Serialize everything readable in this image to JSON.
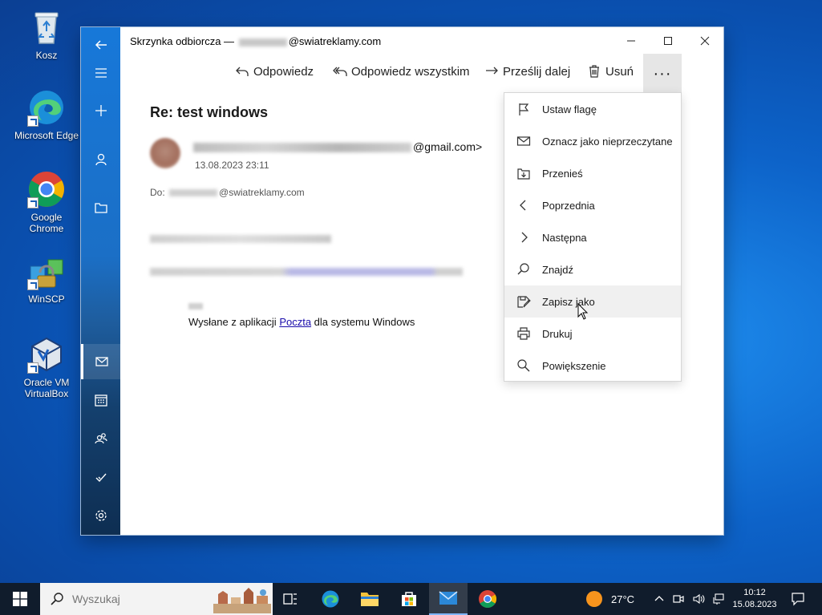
{
  "desktop": {
    "icons": [
      {
        "label": "Kosz"
      },
      {
        "label": "Microsoft Edge"
      },
      {
        "label": "Google Chrome"
      },
      {
        "label": "WinSCP"
      },
      {
        "label": "Oracle VM VirtualBox"
      }
    ]
  },
  "window": {
    "title_prefix": "Skrzynka odbiorcza —",
    "title_suffix": "@swiatreklamy.com"
  },
  "toolbar": {
    "reply": "Odpowiedz",
    "reply_all": "Odpowiedz wszystkim",
    "forward": "Prześlij dalej",
    "delete": "Usuń",
    "more": "···"
  },
  "message": {
    "subject": "Re: test windows",
    "sender_suffix": "@gmail.com>",
    "date": "13.08.2023 23:11",
    "to_label": "Do:",
    "to_suffix": "@swiatreklamy.com",
    "signature_prefix": "Wysłane z aplikacji ",
    "signature_link": "Poczta",
    "signature_suffix": " dla systemu Windows"
  },
  "menu": {
    "items": [
      {
        "label": "Ustaw flagę",
        "icon": "flag-icon"
      },
      {
        "label": "Oznacz jako nieprzeczytane",
        "icon": "envelope-icon"
      },
      {
        "label": "Przenieś",
        "icon": "move-icon"
      },
      {
        "label": "Poprzednia",
        "icon": "chevron-left-icon"
      },
      {
        "label": "Następna",
        "icon": "chevron-right-icon"
      },
      {
        "label": "Znajdź",
        "icon": "find-icon"
      },
      {
        "label": "Zapisz jako",
        "icon": "save-as-icon"
      },
      {
        "label": "Drukuj",
        "icon": "print-icon"
      },
      {
        "label": "Powiększenie",
        "icon": "zoom-icon"
      }
    ],
    "hovered_index": 6
  },
  "taskbar": {
    "search_placeholder": "Wyszukaj",
    "weather_temp": "27°C",
    "time": "10:12",
    "date": "15.08.2023"
  },
  "colors": {
    "accent": "#0078d4",
    "taskbar": "#101c2c",
    "menu_hover": "#f0f0f0"
  }
}
